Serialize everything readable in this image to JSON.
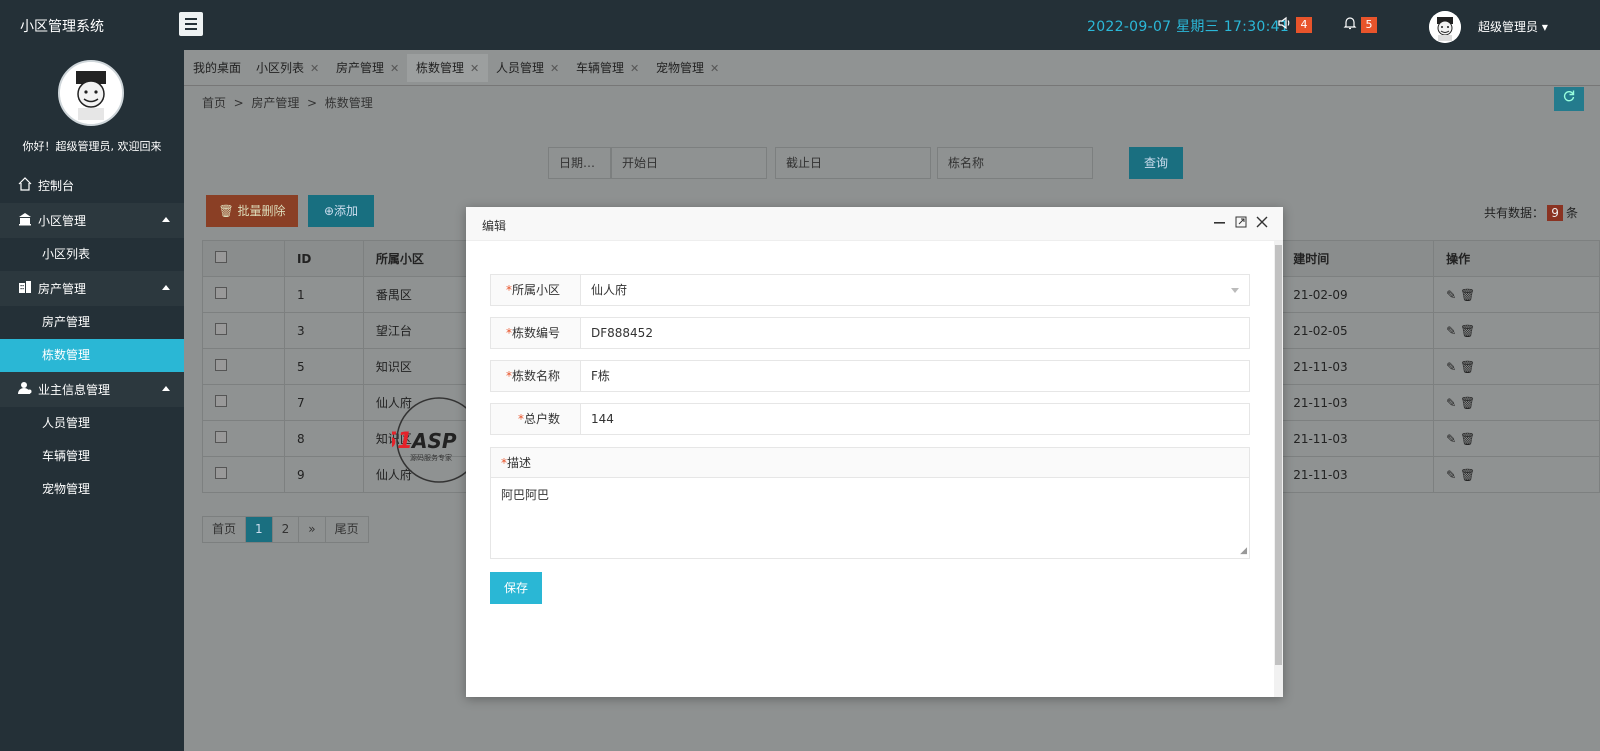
{
  "header": {
    "brand": "小区管理系统",
    "datetime": "2022-09-07   星期三   17:30:41",
    "notifications": [
      {
        "icon": "speaker-icon",
        "count": "4"
      },
      {
        "icon": "bell-icon",
        "count": "5"
      }
    ],
    "user_name": "超级管理员",
    "user_caret": "▾"
  },
  "sidebar": {
    "welcome": "你好！超级管理员, 欢迎回来",
    "dashboard": "控制台",
    "groups": [
      {
        "label": "小区管理",
        "items": [
          "小区列表"
        ]
      },
      {
        "label": "房产管理",
        "items": [
          "房产管理",
          "栋数管理"
        ]
      },
      {
        "label": "业主信息管理",
        "items": [
          "人员管理",
          "车辆管理",
          "宠物管理"
        ]
      }
    ],
    "active_item": "栋数管理"
  },
  "tabs": [
    {
      "label": "我的桌面",
      "closable": false
    },
    {
      "label": "小区列表",
      "closable": true
    },
    {
      "label": "房产管理",
      "closable": true
    },
    {
      "label": "栋数管理",
      "closable": true,
      "active": true
    },
    {
      "label": "人员管理",
      "closable": true
    },
    {
      "label": "车辆管理",
      "closable": true
    },
    {
      "label": "宠物管理",
      "closable": true
    }
  ],
  "tab_close": "✕",
  "breadcrumb": {
    "home": "首页",
    "sep": ">",
    "level1": "房产管理",
    "level2": "栋数管理"
  },
  "filters": {
    "date_label": "日期…",
    "start_placeholder": "开始日",
    "end_placeholder": "截止日",
    "name_placeholder": "栋名称",
    "query": "查询"
  },
  "toolbar": {
    "batch_delete": "批量删除",
    "add": "添加",
    "total_prefix": "共有数据：",
    "total_count": "9",
    "total_suffix": "条"
  },
  "table": {
    "headers": [
      "",
      "ID",
      "所属小区",
      "建时间",
      "操作"
    ],
    "rows": [
      {
        "id": "1",
        "community": "番禺区",
        "time": "21-02-09"
      },
      {
        "id": "3",
        "community": "望江台",
        "time": "21-02-05"
      },
      {
        "id": "5",
        "community": "知识区",
        "time": "21-11-03"
      },
      {
        "id": "7",
        "community": "仙人府",
        "time": "21-11-03"
      },
      {
        "id": "8",
        "community": "知识区",
        "time": "21-11-03"
      },
      {
        "id": "9",
        "community": "仙人府",
        "time": "21-11-03"
      }
    ]
  },
  "pager": {
    "first": "首页",
    "pages": [
      "1",
      "2"
    ],
    "next": "»",
    "last": "尾页",
    "current": "1"
  },
  "watermark": {
    "brand": "51ASPX",
    "tagline": "源码服务专家"
  },
  "modal": {
    "title": "编辑",
    "fields": [
      {
        "label": "所属小区",
        "value": "仙人府",
        "type": "select"
      },
      {
        "label": "栋数编号",
        "value": "DF888452",
        "type": "text"
      },
      {
        "label": "栋数名称",
        "value": "F栋",
        "type": "text"
      },
      {
        "label": "总户数",
        "value": "144",
        "type": "text"
      }
    ],
    "description_label": "描述",
    "description_value": "阿巴阿巴",
    "save": "保存",
    "required_mark": "*"
  },
  "colors": {
    "header_bg": "#243037",
    "accent": "#2ab7d5",
    "danger": "#e8542b"
  }
}
